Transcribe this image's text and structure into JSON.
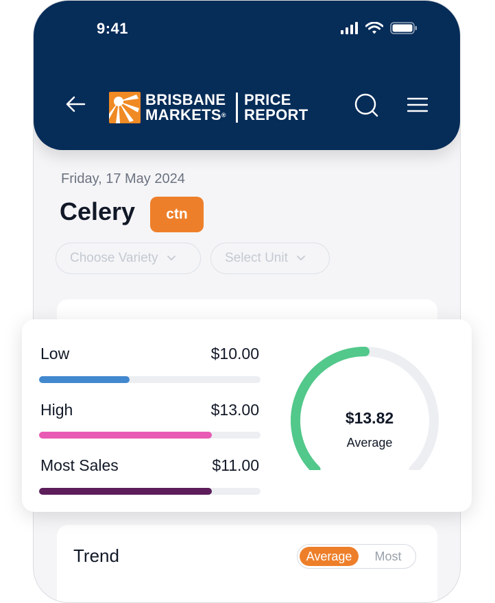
{
  "status_bar": {
    "time": "9:41"
  },
  "header": {
    "brand_line1": "BRISBANE",
    "brand_line2": "MARKETS",
    "brand_reg": "®",
    "report_line1": "PRICE",
    "report_line2": "REPORT",
    "colors": {
      "background": "#062c58",
      "logo": "#f08a24"
    }
  },
  "product": {
    "date": "Friday, 17 May 2024",
    "name": "Celery",
    "unit": "ctn"
  },
  "filters": {
    "variety_placeholder": "Choose Variety",
    "unit_placeholder": "Select Unit"
  },
  "prices": {
    "rows": [
      {
        "label": "Low",
        "value": "$10.00",
        "fill": 0.41,
        "color": "#4288cf"
      },
      {
        "label": "High",
        "value": "$13.00",
        "fill": 0.78,
        "color": "#e85ab3"
      },
      {
        "label": "Most Sales",
        "value": "$11.00",
        "fill": 0.78,
        "color": "#5c1d5a"
      }
    ],
    "average": {
      "value": "$13.82",
      "label": "Average",
      "fill": 0.5,
      "color": "#52c88b",
      "track_color": "#eceef2"
    }
  },
  "trend": {
    "title": "Trend",
    "toggle": {
      "active": "Average",
      "inactive": "Most"
    }
  }
}
